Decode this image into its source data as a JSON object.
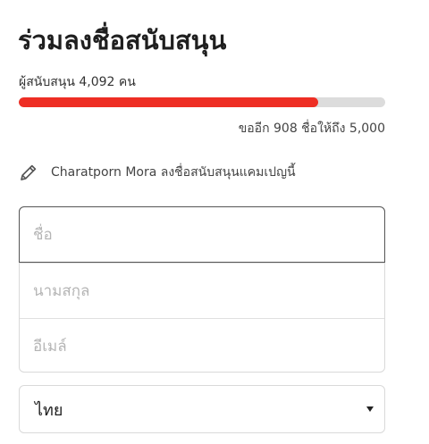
{
  "campaign": {
    "title": "ร่วมลงชื่อสนับสนุน",
    "supporters_text": "ผู้สนับสนุน 4,092 คน",
    "progress_fraction": 0.818,
    "remaining_text": "ขออีก 908 ชื่อให้ถึง 5,000"
  },
  "recent_signer": {
    "icon": "pencil-icon",
    "text": "Charatporn Mora ลงชื่อสนับสนุนแคมเปญนี้"
  },
  "form": {
    "first_name_placeholder": "ชื่อ",
    "last_name_placeholder": "นามสกุล",
    "email_placeholder": "อีเมล์"
  },
  "country_select": {
    "selected": "ไทย"
  },
  "colors": {
    "progress_fill": "#ee2e24",
    "progress_track": "#dcdcdc"
  }
}
